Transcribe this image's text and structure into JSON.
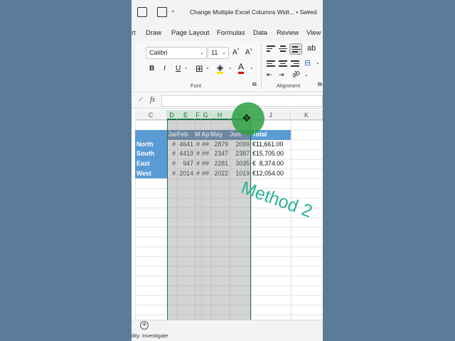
{
  "window": {
    "title": "Change Multiple Excel Columns Widt...",
    "saved_status": "Saved",
    "saved_chevron": "⌄"
  },
  "tabs": [
    "rt",
    "Draw",
    "Page Layout",
    "Formulas",
    "Data",
    "Review",
    "View"
  ],
  "ribbon": {
    "font_name": "Calibri",
    "font_size": "11",
    "grow_font": "A^",
    "shrink_font": "A˅",
    "bold": "B",
    "italic": "I",
    "underline": "U",
    "font_group_label": "Font",
    "alignment_group_label": "Alignment"
  },
  "formula_bar": {
    "fx": "fx",
    "check": "✓"
  },
  "columns": [
    "C",
    "D",
    "E",
    "F",
    "G",
    "H",
    "I",
    "J",
    "K"
  ],
  "table": {
    "total_header": "Total",
    "month_headers": [
      "Jar",
      "Feb",
      "M",
      "Ap",
      "May",
      "Jun"
    ],
    "rows": [
      {
        "region": "North",
        "cells": [
          "#",
          "4641",
          "#",
          "##",
          "2879",
          "2099"
        ],
        "total": "€11,661.00"
      },
      {
        "region": "South",
        "cells": [
          "#",
          "4419",
          "#",
          "##",
          "2347",
          "2387"
        ],
        "total": "€15,705.00"
      },
      {
        "region": "East",
        "cells": [
          "#",
          "947",
          "#",
          "##",
          "2281",
          "3035"
        ],
        "total": "€  8,374.00"
      },
      {
        "region": "West",
        "cells": [
          "#",
          "2014",
          "#",
          "##",
          "2022",
          "1019"
        ],
        "total": "€12,054.00"
      }
    ]
  },
  "watermark": "Method 2",
  "statusbar": {
    "text": "ility: Investigate"
  },
  "sheetbar": {
    "add": "+"
  }
}
